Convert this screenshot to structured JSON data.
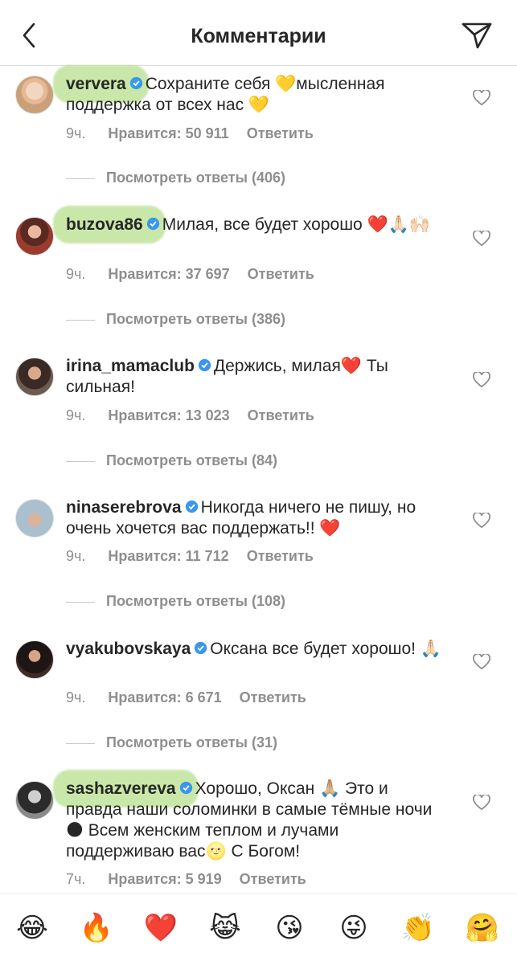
{
  "header": {
    "title": "Комментарии"
  },
  "comments": [
    {
      "user": "ververa",
      "text": "Сохраните себя 💛мысленная поддержка от всех нас 💛",
      "time": "9ч.",
      "likes": "Нравится: 50 911",
      "reply": "Ответить",
      "replies": "Посмотреть ответы (406)"
    },
    {
      "user": "buzova86",
      "text": "Милая, все будет хорошо ❤️🙏🏻🙌🏻",
      "time": "9ч.",
      "likes": "Нравится: 37 697",
      "reply": "Ответить",
      "replies": "Посмотреть ответы (386)"
    },
    {
      "user": "irina_mamaclub",
      "text": "Держись, милая❤️ Ты сильная!",
      "time": "9ч.",
      "likes": "Нравится: 13 023",
      "reply": "Ответить",
      "replies": "Посмотреть ответы (84)"
    },
    {
      "user": "ninaserebrova",
      "text": "Никогда ничего не пишу, но очень хочется вас поддержать!! ❤️",
      "time": "9ч.",
      "likes": "Нравится: 11 712",
      "reply": "Ответить",
      "replies": "Посмотреть ответы (108)"
    },
    {
      "user": "vyakubovskaya",
      "text": "Оксана все будет хорошо! 🙏🏻",
      "time": "9ч.",
      "likes": "Нравится: 6 671",
      "reply": "Ответить",
      "replies": "Посмотреть ответы (31)"
    },
    {
      "user": "sashazvereva",
      "text": "Хорошо, Оксан 🙏🏼 Это и правда наши соломинки в самые тёмные ночи 🌑 Всем женским теплом и лучами поддерживаю вас🌝 С Богом!",
      "time": "7ч.",
      "likes": "Нравится: 5 919",
      "reply": "Ответить"
    }
  ],
  "emojis": [
    "😂",
    "🔥",
    "❤️",
    "😹",
    "😘",
    "😜",
    "👏",
    "🤗"
  ],
  "colors": {
    "highlight": "#b7df8d",
    "verified": "#3897f0",
    "meta": "#8e8e8e"
  }
}
